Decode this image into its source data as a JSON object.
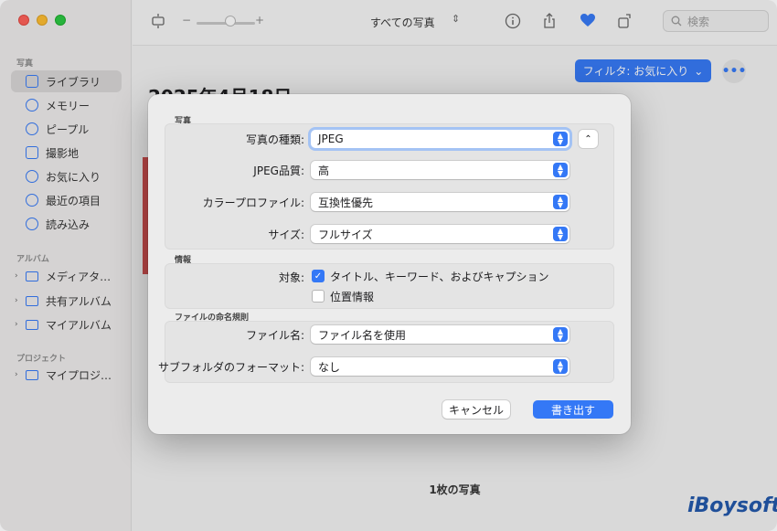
{
  "sidebar": {
    "section_photos": "写真",
    "items": [
      {
        "label": "ライブラリ"
      },
      {
        "label": "メモリー"
      },
      {
        "label": "ピープル"
      },
      {
        "label": "撮影地"
      },
      {
        "label": "お気に入り"
      },
      {
        "label": "最近の項目"
      },
      {
        "label": "読み込み"
      }
    ],
    "section_albums": "アルバム",
    "albums": [
      {
        "label": "メディアタ…"
      },
      {
        "label": "共有アルバム"
      },
      {
        "label": "マイアルバム"
      }
    ],
    "section_projects": "プロジェクト",
    "projects": [
      {
        "label": "マイプロジ…"
      }
    ]
  },
  "toolbar": {
    "zoom_minus": "−",
    "zoom_plus": "+",
    "view_selector": "すべての写真",
    "search_placeholder": "検索"
  },
  "main": {
    "filter_button": "フィルタ: お気に入り",
    "more_button": "•••",
    "date_heading": "2025年4月18日",
    "photo_count": "1枚の写真",
    "watermark": "iBoysoft"
  },
  "dialog": {
    "group_photo": "写真",
    "photo_kind_label": "写真の種類:",
    "photo_kind_value": "JPEG",
    "jpeg_quality_label": "JPEG品質:",
    "jpeg_quality_value": "高",
    "color_profile_label": "カラープロファイル:",
    "color_profile_value": "互換性優先",
    "size_label": "サイズ:",
    "size_value": "フルサイズ",
    "group_info": "情報",
    "target_label": "対象:",
    "checkbox_title_keywords": "タイトル、キーワード、およびキャプション",
    "checkbox_location": "位置情報",
    "group_naming": "ファイルの命名規則",
    "filename_label": "ファイル名:",
    "filename_value": "ファイル名を使用",
    "subfolder_label": "サブフォルダのフォーマット:",
    "subfolder_value": "なし",
    "cancel_button": "キャンセル",
    "export_button": "書き出す"
  },
  "colors": {
    "accent": "#3478f6",
    "watermark": "#1f4f99"
  }
}
